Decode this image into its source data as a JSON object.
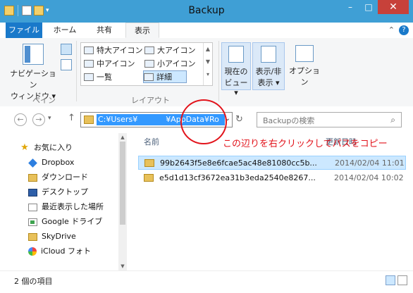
{
  "window": {
    "title": "Backup"
  },
  "qat": {
    "dropdown": "▾"
  },
  "window_buttons": {
    "minimize": "–",
    "maximize": "□",
    "close": "✕"
  },
  "tabs": {
    "file": "ファイル",
    "home": "ホーム",
    "share": "共有",
    "view": "表示"
  },
  "ribbon": {
    "navpane": {
      "label1": "ナビゲーション",
      "label2": "ウィンドウ ▾"
    },
    "pane_group": "ペイン",
    "layout_group": "レイアウト",
    "layout_items": {
      "xl_icons": "特大アイコン",
      "l_icons": "大アイコン",
      "m_icons": "中アイコン",
      "s_icons": "小アイコン",
      "list": "一覧",
      "details": "詳細"
    },
    "current_view": {
      "line1": "現在の",
      "line2": "ビュー ▾"
    },
    "show_hide": {
      "line1": "表示/非",
      "line2": "表示 ▾"
    },
    "options": "オプション"
  },
  "address": {
    "path_prefix": "C:¥Users¥",
    "path_suffix": "¥AppData¥Ro",
    "search_placeholder": "Backupの検索"
  },
  "nav": {
    "favorites": "お気に入り",
    "items": [
      "Dropbox",
      "ダウンロード",
      "デスクトップ",
      "最近表示した場所",
      "Google ドライブ",
      "SkyDrive",
      "iCloud フォト"
    ]
  },
  "columns": {
    "name": "名前",
    "date": "更新日時"
  },
  "files": [
    {
      "name": "99b2643f5e8e6fcae5ac48e81080cc5b...",
      "date": "2014/02/04 11:01"
    },
    {
      "name": "e5d1d13cf3672ea31b3eda2540e8267...",
      "date": "2014/02/04 10:02"
    }
  ],
  "annotation": "この辺りを右クリックしてパスをコピー",
  "status": {
    "count": "2 個の項目"
  }
}
